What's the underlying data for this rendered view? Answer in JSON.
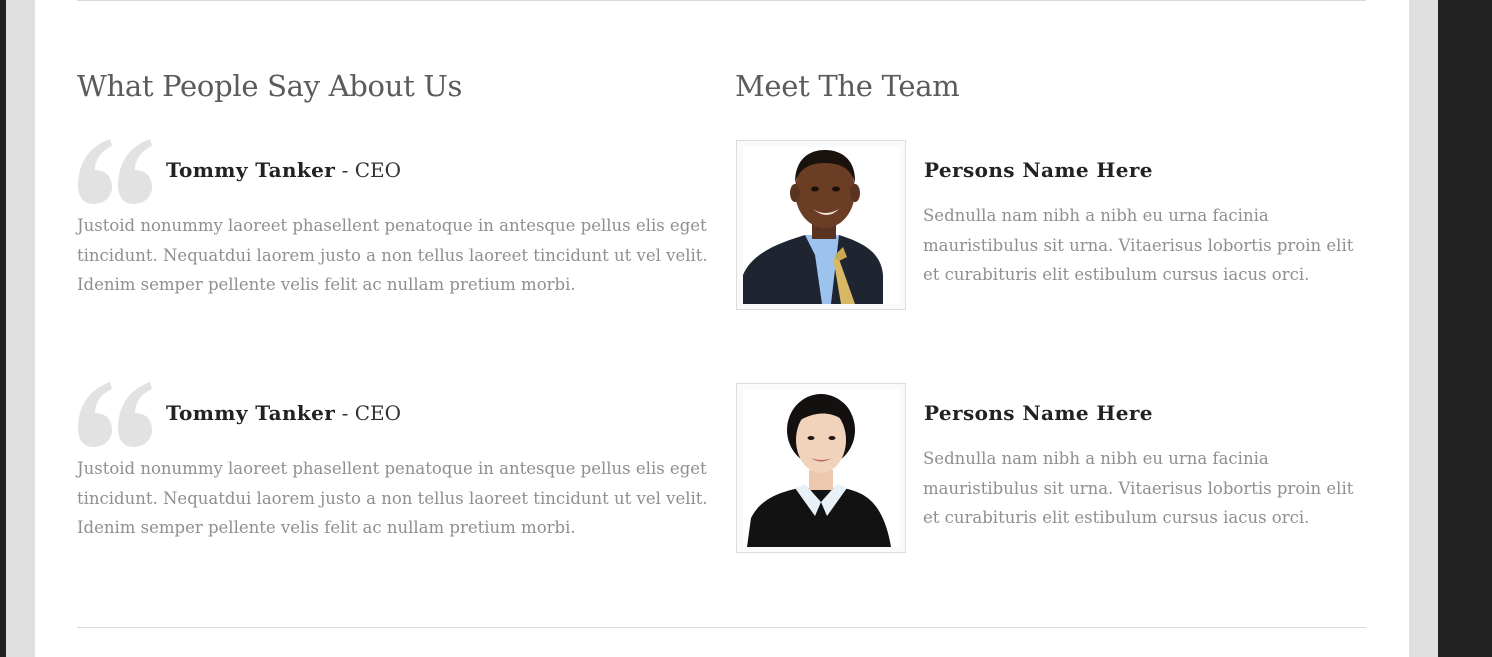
{
  "testimonials_section": {
    "title": "What People Say About Us",
    "items": [
      {
        "name": "Tommy Tanker",
        "separator": " - ",
        "role": "CEO",
        "quote": "Justoid nonummy laoreet phasellent penatoque in antesque pellus elis eget tincidunt. Nequatdui laorem justo a non tellus laoreet tincidunt ut vel velit. Idenim semper pellente velis felit ac nullam pretium morbi."
      },
      {
        "name": "Tommy Tanker",
        "separator": " - ",
        "role": "CEO",
        "quote": "Justoid nonummy laoreet phasellent penatoque in antesque pellus elis eget tincidunt. Nequatdui laorem justo a non tellus laoreet tincidunt ut vel velit. Idenim semper pellente velis felit ac nullam pretium morbi."
      }
    ]
  },
  "team_section": {
    "title": "Meet The Team",
    "members": [
      {
        "name": "Persons Name Here",
        "bio": "Sednulla nam nibh a nibh eu urna facinia mauristibulus sit urna. Vitaerisus lobortis proin elit et curabituris elit estibulum cursus iacus orci."
      },
      {
        "name": "Persons Name Here",
        "bio": "Sednulla nam nibh a nibh eu urna facinia mauristibulus sit urna. Vitaerisus lobortis proin elit et curabituris elit estibulum cursus iacus orci."
      }
    ]
  },
  "colors": {
    "page_background": "#222222",
    "frame": "#e0e0e0",
    "panel": "#ffffff",
    "heading": "#5b5b5b",
    "body_text": "#8f8f8f",
    "quote_mark": "#e2e2e2"
  },
  "icons": {
    "quote": "opening-quote-icon"
  }
}
